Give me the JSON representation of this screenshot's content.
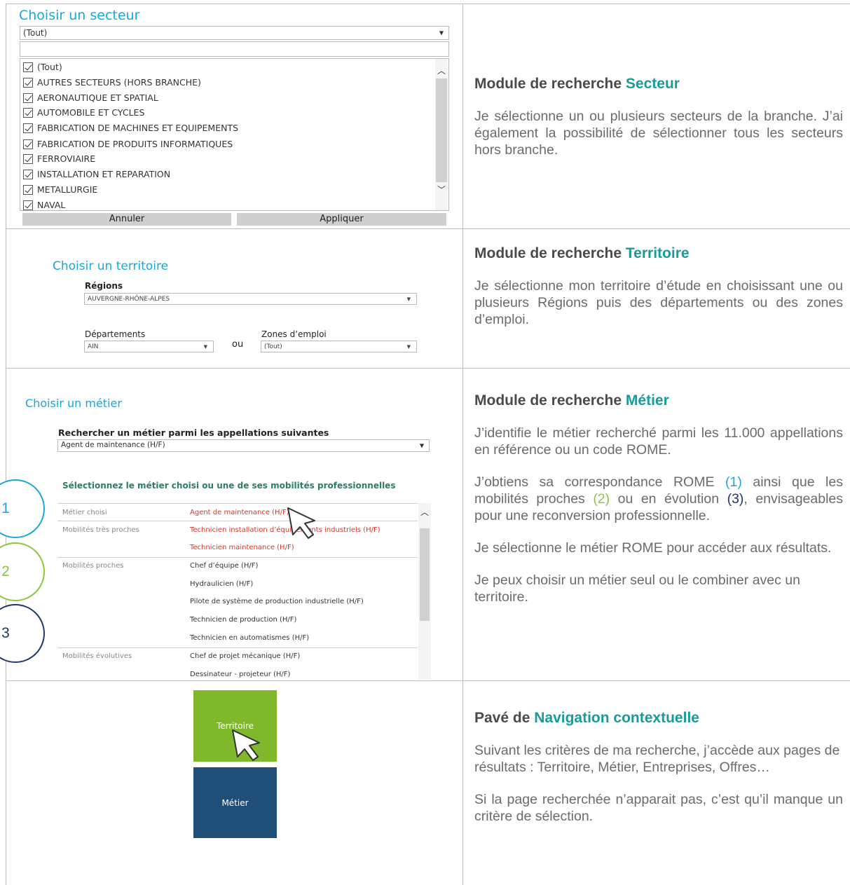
{
  "secteur": {
    "title": "Choisir un secteur",
    "combo_value": "(Tout)",
    "items": [
      "(Tout)",
      " AUTRES SECTEURS (HORS BRANCHE)",
      "AERONAUTIQUE ET SPATIAL",
      "AUTOMOBILE ET CYCLES",
      "FABRICATION DE MACHINES ET EQUIPEMENTS",
      "FABRICATION DE PRODUITS INFORMATIQUES",
      "FERROVIAIRE",
      "INSTALLATION ET REPARATION",
      "METALLURGIE",
      "NAVAL"
    ],
    "cancel_label": "Annuler",
    "apply_label": "Appliquer"
  },
  "territoire": {
    "title": "Choisir un territoire",
    "regions_label": "Régions",
    "regions_value": "AUVERGNE-RHÔNE-ALPES",
    "departements_label": "Départements",
    "departements_value": "AIN",
    "ou_label": "ou",
    "zones_label": "Zones d’emploi",
    "zones_value": "(Tout)"
  },
  "metier": {
    "title": "Choisir un métier",
    "search_label": "Rechercher un métier parmi les appellations suivantes",
    "search_value": "Agent de maintenance (H/F)",
    "select_heading": "Sélectionnez le métier choisi ou une de ses mobilités professionnelles",
    "rows": [
      {
        "category": "Métier choisi",
        "job": "Agent de maintenance (H/F)",
        "red": true
      },
      {
        "category": "Mobilités très proches",
        "job": "Technicien installation d’équipements industriels (H/F)",
        "red": true
      },
      {
        "category": "",
        "job": "Technicien maintenance (H/F)",
        "red": true
      },
      {
        "category": "Mobilités proches",
        "job": "Chef d’équipe (H/F)",
        "red": false
      },
      {
        "category": "",
        "job": "Hydraulicien (H/F)",
        "red": false
      },
      {
        "category": "",
        "job": "Pilote de système de production industrielle (H/F)",
        "red": false
      },
      {
        "category": "",
        "job": "Technicien de production (H/F)",
        "red": false
      },
      {
        "category": "",
        "job": "Technicien en automatismes (H/F)",
        "red": false
      },
      {
        "category": "Mobilités évolutives",
        "job": "Chef de projet mécanique (H/F)",
        "red": false
      },
      {
        "category": "",
        "job": "Dessinateur - projeteur (H/F)",
        "red": false
      }
    ],
    "circles": [
      "1",
      "2",
      "3"
    ]
  },
  "navigation": {
    "tile_territoire": "Territoire",
    "tile_metier": "Métier",
    "colors": {
      "territoire": "#7fb82a",
      "metier": "#1f4e79"
    }
  },
  "descriptions": {
    "secteur": {
      "heading_prefix": "Module de recherche ",
      "heading_accent": "Secteur",
      "p1": "Je sélectionne un ou plusieurs secteurs de la branche. J’ai également la possibilité de sélectionner tous les secteurs hors branche."
    },
    "territoire": {
      "heading_prefix": "Module de recherche ",
      "heading_accent": "Territoire",
      "p1": "Je sélectionne mon territoire d’étude en choisissant une ou plusieurs Régions puis des départements ou des zones d’emploi."
    },
    "metier": {
      "heading_prefix": "Module de recherche ",
      "heading_accent": "Métier",
      "p1": "J’identifie le métier recherché parmi les 11.000 appellations en référence ou un code ROME.",
      "p2_a": "J’obtiens sa correspondance ROME ",
      "p2_n1": "(1)",
      "p2_b": " ainsi que les mobilités proches ",
      "p2_n2": "(2)",
      "p2_c": " ou en évolution ",
      "p2_n3": "(3)",
      "p2_d": ", envisageables pour une reconversion professionnelle.",
      "p3": "Je sélectionne le métier ROME pour accéder aux résultats.",
      "p4": "Je peux choisir un métier seul ou le combiner avec un territoire."
    },
    "navigation": {
      "heading_prefix": "Pavé de ",
      "heading_accent": "Navigation contextuelle",
      "p1": "Suivant les critères de ma recherche, j’accède aux pages de résultats : Territoire, Métier, Entreprises, Offres…",
      "p2": "Si la page recherchée n’apparait pas, c’est qu’il manque un critère de sélection."
    }
  }
}
